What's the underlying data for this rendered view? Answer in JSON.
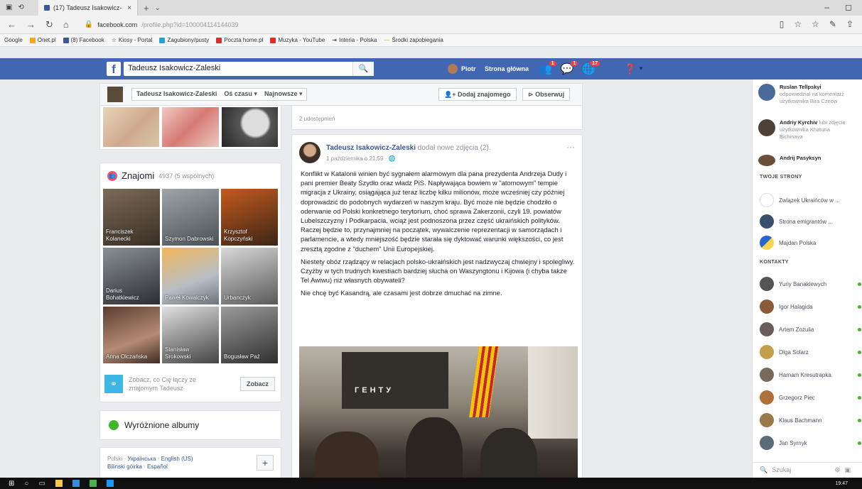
{
  "browser": {
    "tab_title": "(17) Tadeusz Isakowicz-",
    "url_host": "facebook.com",
    "url_rest": "/profile.php?id=100004114144039",
    "bookmarks": [
      "Google",
      "Onet.pl",
      "(8) Facebook",
      "Kiosy - Portal",
      "Zagubiony/pusty",
      "Poczta home.pl",
      "Muzyka - YouTube",
      "Interia - Polska",
      "Środki zapobiegania"
    ]
  },
  "fb": {
    "logo": "f",
    "search_value": "Tadeusz Isakowicz-Zaleski",
    "user_name": "Piotr",
    "home_label": "Strona główna",
    "badges": [
      "1",
      "1",
      "17"
    ]
  },
  "timeline": {
    "name": "Tadeusz Isakowicz-Zaleski",
    "menu_1": "Oś czasu ▾",
    "menu_2": "Najnowsze ▾",
    "add_friend": "Dodaj znajomego",
    "follow": "Obserwuj"
  },
  "friends": {
    "title": "Znajomi",
    "count": "4937 (5 wspólnych)",
    "items": [
      {
        "name": "Franciszek Kolanecki"
      },
      {
        "name": "Szymon Dabrowski"
      },
      {
        "name": "Krzysztof Kopczyński"
      },
      {
        "name": "Darius Bohatkiewicz"
      },
      {
        "name": "Paweł Kowalczyk"
      },
      {
        "name": "Urbanczyk"
      },
      {
        "name": "Anna Olczańska"
      },
      {
        "name": "Stanisław Srokowski"
      },
      {
        "name": "Bogusław Paź"
      }
    ],
    "see_text": "Zobacz, co Cię łączy ze znajomym Tadeusz",
    "see_button": "Zobacz"
  },
  "albums": {
    "title": "Wyróżnione albumy"
  },
  "languages": {
    "line1_a": "Polski",
    "line1_b": "Українська",
    "line1_c": "English (US)",
    "line2_a": "Bilinski góirka",
    "line2_b": "Español"
  },
  "post": {
    "shared_count": "2 udostępnień",
    "author": "Tadeusz Isakowicz-Zaleski",
    "action": "dodał nowe zdjęcia (2).",
    "meta": "1 października o 21:59 ·",
    "paragraphs": [
      "Konflikt w Katalonii winien być sygnałem alarmowym dla pana prezydenta Andrzeja Dudy i pani premier Beaty Szydło oraz władz PiS. Napływająca bowiem w \"atomowym\" tempie migracja z Ukrainy, osiągająca już teraz liczbę kilku milionów, może wcześniej czy później doprowadzić do podobnych wydarzeń w naszym kraju. Być może nie będzie chodziło o oderwanie od Polski konkretnego terytorium, choć sprawa Zakerzonii, czyli 19. powiatów Lubelszczyzny i Podkarpacia, wciąż jest podnoszona przez część ukraińskich polityków. Raczej będzie to, przynajmniej na początek, wywalczenie reprezentacji w samorządach i parlamencie, a wtedy mniejszość będzie starała się dyktować warunki większości, co jest zresztą zgodne z \"duchem\" Unii Europejskiej.",
      "Niestety obóz rządzący w relacjach polsko-ukraińskich jest nadzwyczaj chwiejny i spolegliwy. Czyżby w tych trudnych kwestiach bardziej słucha on Waszyngtonu i Kijowa (i chyba także Tel Awiwu) niż własnych obywateli?",
      "Nie chcę być Kasandrą, ale czasami jest dobrze dmuchać na zimne."
    ],
    "photo_banner_text": "ГЕНТУ"
  },
  "sidebar": {
    "notifications": [
      {
        "name": "Ruslan Tellpskyi",
        "text1": "odpowiedział na komentarz",
        "text2": "użytkownika Bira Czeow"
      },
      {
        "name": "Andriy Kyrchiv",
        "text1": "lubi zdjęcie",
        "text2": "użytkownika Khatuna",
        "text3": "Bichinava"
      },
      {
        "name": "Andrij Pasyksyn",
        "text1": ""
      }
    ],
    "pages_title": "TWOJE STRONY",
    "pages": [
      {
        "name": "Związek Ukraińców w ..."
      },
      {
        "name": "Strona emigrantów ..."
      },
      {
        "name": "Majdan Polska"
      }
    ],
    "contacts_title": "KONTAKTY",
    "contacts": [
      {
        "name": "Yuriy Banakiewych"
      },
      {
        "name": "Igor Halagida"
      },
      {
        "name": "Artem Zozulia"
      },
      {
        "name": "Olga Solarz"
      },
      {
        "name": "Harnam Kresutrapka"
      },
      {
        "name": "Grzegorz Piec"
      },
      {
        "name": "Klaus Bachmann"
      },
      {
        "name": "Jan Syrnyk"
      }
    ],
    "chat_search": "Szukaj"
  },
  "taskbar": {
    "clock": "19:47"
  },
  "colors": {
    "fb_blue": "#4267b2",
    "link_blue": "#365899",
    "online_green": "#42b72a"
  }
}
